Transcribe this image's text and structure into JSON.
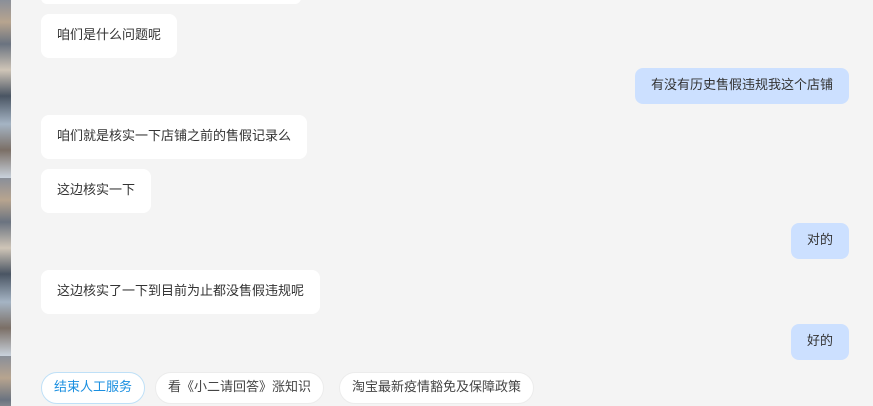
{
  "messages": [
    {
      "side": "agent",
      "text": "咱们是什么问题呢"
    },
    {
      "side": "user",
      "text": "有没有历史售假违规我这个店铺"
    },
    {
      "side": "agent",
      "text": "咱们就是核实一下店铺之前的售假记录么"
    },
    {
      "side": "agent",
      "text": "这边核实一下"
    },
    {
      "side": "user",
      "text": "对的"
    },
    {
      "side": "agent",
      "text": "这边核实了一下到目前为止都没售假违规呢"
    },
    {
      "side": "user",
      "text": "好的"
    }
  ],
  "quick_actions": [
    {
      "label": "结束人工服务"
    },
    {
      "label": "看《小二请回答》涨知识"
    },
    {
      "label": "淘宝最新疫情豁免及保障政策"
    }
  ],
  "colors": {
    "background": "#f4f4f4",
    "agent_bubble": "#ffffff",
    "user_bubble": "#cce0ff",
    "accent": "#1a8fe0"
  }
}
